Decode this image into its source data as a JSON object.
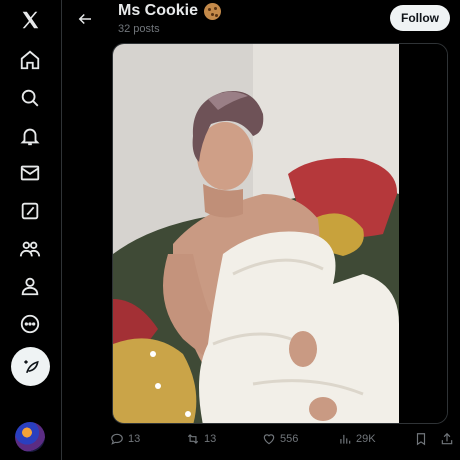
{
  "header": {
    "title": "Ms Cookie",
    "posts_count": "32 posts",
    "follow_label": "Follow"
  },
  "sidebar": {
    "items": [
      {
        "icon": "x-logo-icon"
      },
      {
        "icon": "home-icon"
      },
      {
        "icon": "search-icon"
      },
      {
        "icon": "bell-icon"
      },
      {
        "icon": "mail-icon"
      },
      {
        "icon": "grok-icon"
      },
      {
        "icon": "communities-icon"
      },
      {
        "icon": "profile-icon"
      },
      {
        "icon": "more-icon"
      },
      {
        "icon": "compose-icon"
      }
    ]
  },
  "post_actions": {
    "replies": "13",
    "reposts": "13",
    "likes": "556",
    "views": "29K"
  },
  "colors": {
    "background": "#000000",
    "text": "#e7e9ea",
    "muted": "#71767b",
    "border": "#2f3336",
    "follow_bg": "#eff3f4"
  }
}
